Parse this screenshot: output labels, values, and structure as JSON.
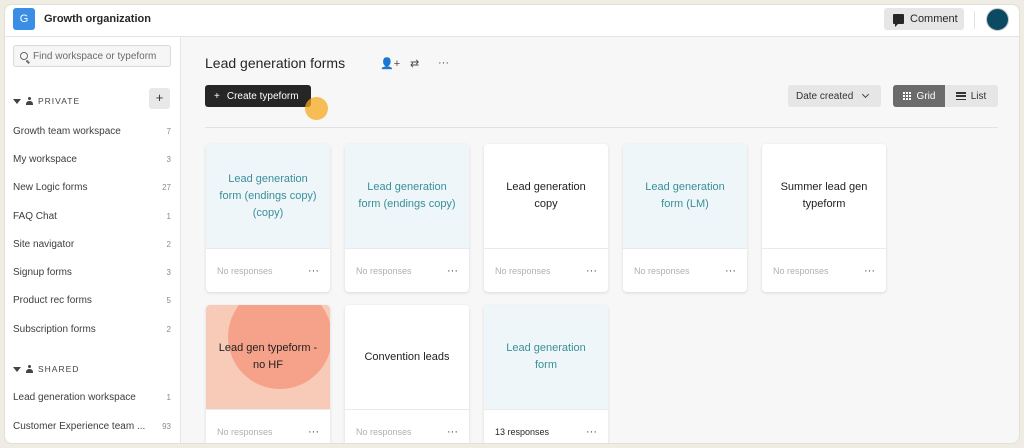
{
  "org": {
    "initial": "G",
    "name": "Growth organization"
  },
  "header": {
    "comment_label": "Comment"
  },
  "sidebar": {
    "search_placeholder": "Find workspace or typeform",
    "private_label": "PRIVATE",
    "shared_label": "SHARED",
    "add_label": "+",
    "private_items": [
      {
        "label": "Growth team workspace",
        "count": "7"
      },
      {
        "label": "My workspace",
        "count": "3"
      },
      {
        "label": "New Logic forms",
        "count": "27"
      },
      {
        "label": "FAQ Chat",
        "count": "1"
      },
      {
        "label": "Site navigator",
        "count": "2"
      },
      {
        "label": "Signup forms",
        "count": "3"
      },
      {
        "label": "Product rec forms",
        "count": "5"
      },
      {
        "label": "Subscription forms",
        "count": "2"
      }
    ],
    "shared_items": [
      {
        "label": "Lead generation workspace",
        "count": "1"
      },
      {
        "label": "Customer Experience team ...",
        "count": "93"
      }
    ]
  },
  "main": {
    "title": "Lead generation forms",
    "create_label": "Create typeform",
    "sort_label": "Date created",
    "view_grid": "Grid",
    "view_list": "List",
    "more_glyph": "···",
    "cards": [
      {
        "title": "Lead generation form (endings copy) (copy)",
        "responses": "No responses",
        "style": "tint"
      },
      {
        "title": "Lead generation form (endings copy)",
        "responses": "No responses",
        "style": "tint"
      },
      {
        "title": "Lead generation copy",
        "responses": "No responses",
        "style": "plain"
      },
      {
        "title": "Lead generation form (LM)",
        "responses": "No responses",
        "style": "tint"
      },
      {
        "title": "Summer lead gen typeform",
        "responses": "No responses",
        "style": "plain"
      },
      {
        "title": "Lead gen typeform - no HF",
        "responses": "No responses",
        "style": "coral"
      },
      {
        "title": "Convention leads",
        "responses": "No responses",
        "style": "plain"
      },
      {
        "title": "Lead generation form",
        "responses": "13 responses",
        "style": "tint"
      }
    ]
  },
  "colors": {
    "accent_teal": "#3a8f99",
    "dark": "#262627",
    "org_blue": "#3a8ee6",
    "coral": "#f6a28a",
    "cursor_orange": "#f7aa1e"
  }
}
